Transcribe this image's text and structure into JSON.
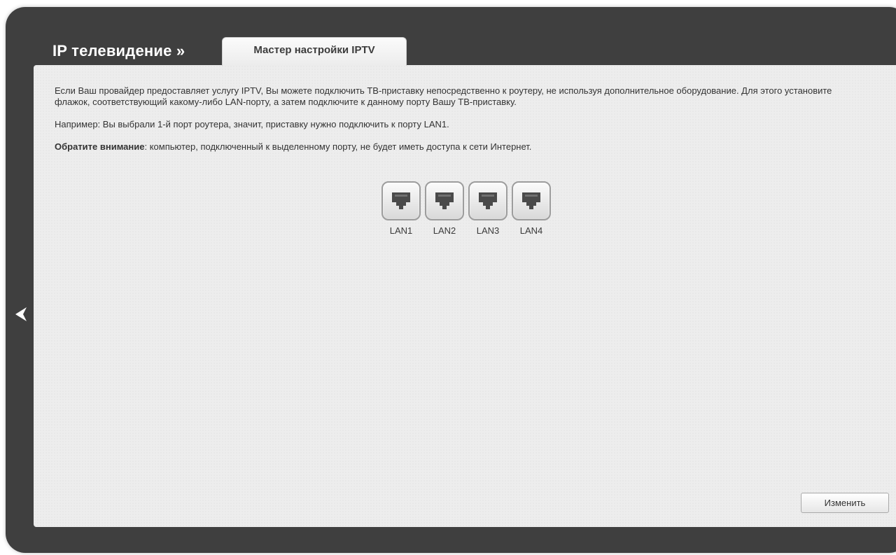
{
  "header": {
    "title": "IP телевидение »"
  },
  "tabs": [
    {
      "label": "Мастер настройки IPTV",
      "active": true
    }
  ],
  "main": {
    "paragraph_1": "Если Ваш провайдер предоставляет услугу IPTV, Вы можете подключить ТВ-приставку непосредственно к роутеру, не используя дополнительное оборудование. Для этого установите флажок, соответствующий какому-либо LAN-порту, а затем подключите к данному порту Вашу ТВ-приставку.",
    "paragraph_2": "Например: Вы выбрали 1-й порт роутера, значит, приставку нужно подключить к порту LAN1.",
    "note_label": "Обратите внимание",
    "note_text": ": компьютер, подключенный к выделенному порту, не будет иметь доступа к сети Интернет.",
    "ports": [
      {
        "label": "LAN1",
        "icon": "ethernet-port-icon",
        "selected": false
      },
      {
        "label": "LAN2",
        "icon": "ethernet-port-icon",
        "selected": false
      },
      {
        "label": "LAN3",
        "icon": "ethernet-port-icon",
        "selected": false
      },
      {
        "label": "LAN4",
        "icon": "ethernet-port-icon",
        "selected": false
      }
    ],
    "change_button": "Изменить"
  },
  "navigation": {
    "back_icon": "chevron-left-icon"
  },
  "colors": {
    "frame": "#3f3f3f",
    "content_bg": "#ededed",
    "text": "#333333"
  }
}
